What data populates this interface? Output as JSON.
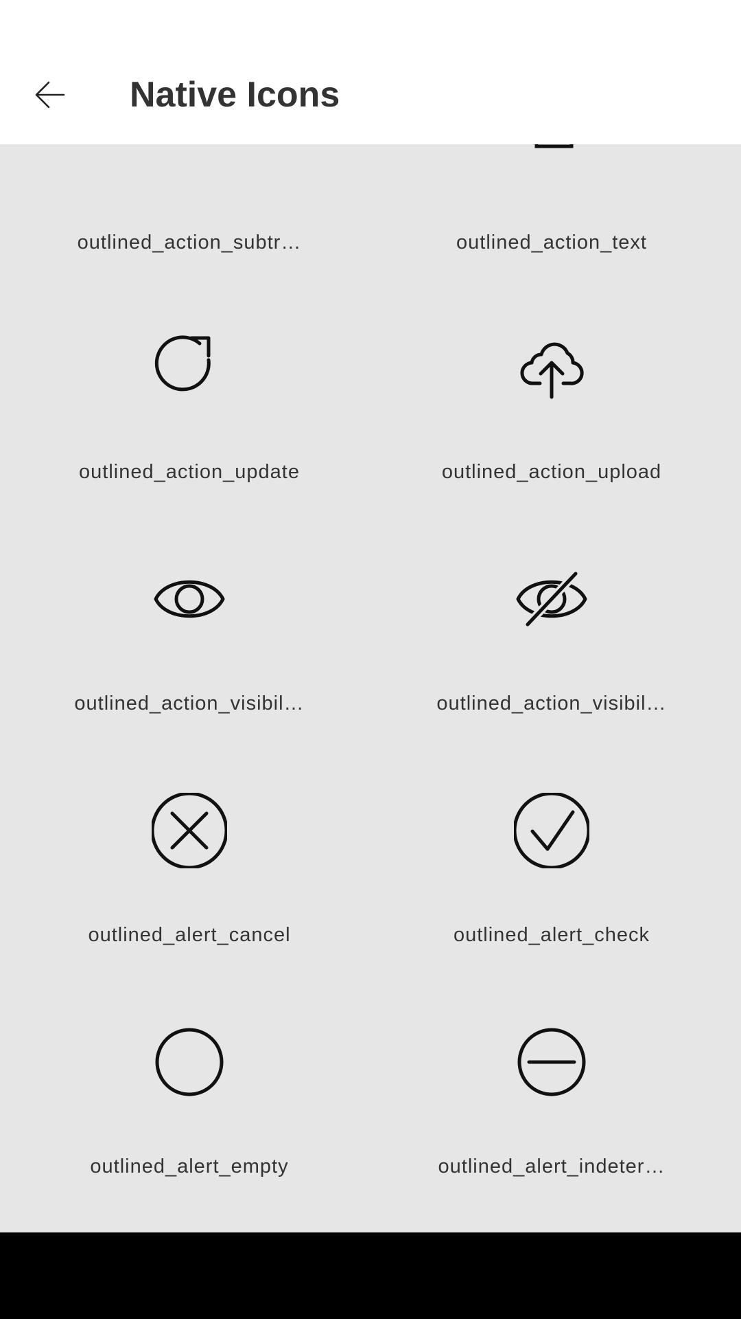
{
  "header": {
    "title": "Native Icons",
    "back_icon": "arrow-back-icon"
  },
  "tiles": [
    {
      "label": "outlined_action_subtr…",
      "icon": "subtract-icon"
    },
    {
      "label": "outlined_action_text",
      "icon": "text-icon"
    },
    {
      "label": "outlined_action_update",
      "icon": "refresh-icon"
    },
    {
      "label": "outlined_action_upload",
      "icon": "cloud-upload-icon"
    },
    {
      "label": "outlined_action_visibil…",
      "icon": "eye-icon"
    },
    {
      "label": "outlined_action_visibil…",
      "icon": "eye-off-icon"
    },
    {
      "label": "outlined_alert_cancel",
      "icon": "circle-x-icon"
    },
    {
      "label": "outlined_alert_check",
      "icon": "circle-check-icon"
    },
    {
      "label": "outlined_alert_empty",
      "icon": "circle-empty-icon"
    },
    {
      "label": "outlined_alert_indeter…",
      "icon": "circle-minus-icon"
    }
  ],
  "colors": {
    "app_bar": "#ffffff",
    "background": "#e6e6e6",
    "text": "#333333",
    "icon_stroke": "#111111",
    "nav_bar": "#000000"
  }
}
